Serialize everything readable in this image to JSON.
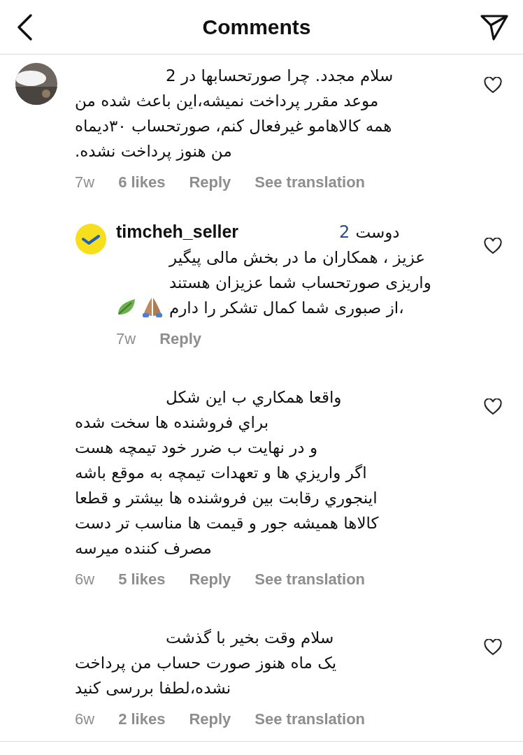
{
  "header": {
    "title": "Comments"
  },
  "comments": [
    {
      "kind": "comment",
      "first_line": "سلام مجدد. چرا صورتحسابها در 2",
      "body": "موعد مقرر پرداخت نمیشه،این باعث شده من\nهمه کالاهامو غیرفعال کنم، صورتحساب ۳۰دیماه\nمن هنوز پرداخت نشده.",
      "time": "7w",
      "likes": "6 likes",
      "reply": "Reply",
      "translate": "See translation",
      "liked": false
    },
    {
      "kind": "reply",
      "avatar": {
        "kind": "badge"
      },
      "username": "timcheh_seller",
      "mention": "2",
      "first_line": "دوست",
      "body": "عزیز ، همکاران ما در بخش مالی پیگیر\nواریزی صورتحساب شما عزیزان هستند\n،از صبوری شما کمال تشکر را دارم",
      "emoji": true,
      "time": "7w",
      "reply": "Reply",
      "liked": false
    },
    {
      "kind": "comment",
      "first_line": "واقعا همكاري ب اين شكل",
      "body": "براي فروشنده ها سخت شده\nو در نهايت ب ضرر خود تيمچه هست\nاگر واريزي ها و تعهدات تيمچه به موقع باشه\nاينجوري رقابت بين فروشنده ها بيشتر و قطعا\nكالاها هميشه جور و قيمت ها مناسب تر دست\nمصرف كننده ميرسه",
      "time": "6w",
      "likes": "5 likes",
      "reply": "Reply",
      "translate": "See translation",
      "liked": false
    },
    {
      "kind": "comment",
      "first_line": "سلام وقت بخير با گذشت",
      "body": "یک ماه هنوز صورت حساب من پرداخت\nنشده،لطفا بررسی کنید",
      "time": "6w",
      "likes": "2 likes",
      "reply": "Reply",
      "translate": "See translation",
      "liked": false
    }
  ]
}
